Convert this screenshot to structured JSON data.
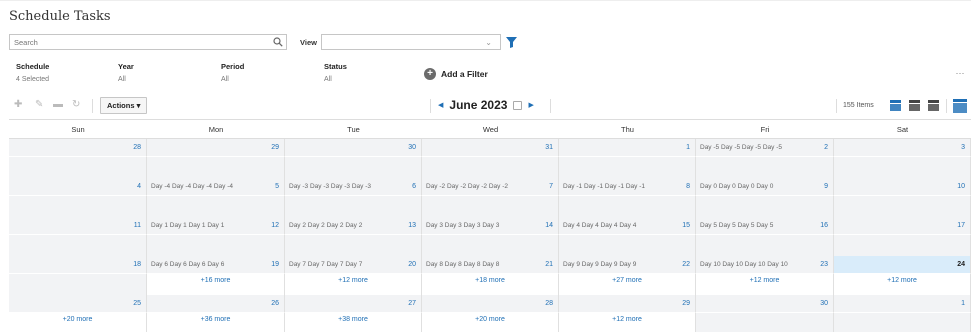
{
  "page": {
    "title": "Schedule Tasks"
  },
  "search": {
    "placeholder": "Search"
  },
  "view": {
    "label": "View",
    "value": ""
  },
  "filters": [
    {
      "label": "Schedule",
      "value": "4 Selected"
    },
    {
      "label": "Year",
      "value": "All"
    },
    {
      "label": "Period",
      "value": "All"
    },
    {
      "label": "Status",
      "value": "All"
    }
  ],
  "add_filter": {
    "label": "Add a Filter"
  },
  "toolbar": {
    "actions_label": "Actions",
    "month": "June 2023",
    "count": "155 Items"
  },
  "calendar": {
    "days": [
      "Sun",
      "Mon",
      "Tue",
      "Wed",
      "Thu",
      "Fri",
      "Sat"
    ],
    "weeks": [
      {
        "dates": [
          "28",
          "29",
          "30",
          "31",
          "1",
          "2",
          "3"
        ],
        "events": [
          "",
          "",
          "",
          "",
          "",
          "Day -5 Day -5 Day -5 Day -5",
          ""
        ],
        "more": [
          "",
          "",
          "",
          "",
          "",
          "",
          ""
        ]
      },
      {
        "dates": [
          "4",
          "5",
          "6",
          "7",
          "8",
          "9",
          "10"
        ],
        "events": [
          "",
          "Day -4 Day -4 Day -4 Day -4",
          "Day -3 Day -3 Day -3 Day -3",
          "Day -2 Day -2 Day -2 Day -2",
          "Day -1 Day -1 Day -1 Day -1",
          "Day 0 Day 0 Day 0 Day 0",
          ""
        ],
        "more": [
          "",
          "",
          "",
          "",
          "",
          "",
          ""
        ]
      },
      {
        "dates": [
          "11",
          "12",
          "13",
          "14",
          "15",
          "16",
          "17"
        ],
        "events": [
          "",
          "Day 1 Day 1 Day 1 Day 1",
          "Day 2 Day 2 Day 2 Day 2",
          "Day 3 Day 3 Day 3 Day 3",
          "Day 4 Day 4 Day 4 Day 4",
          "Day 5 Day 5 Day 5 Day 5",
          ""
        ],
        "more": [
          "",
          "",
          "",
          "",
          "",
          "",
          ""
        ]
      },
      {
        "dates": [
          "18",
          "19",
          "20",
          "21",
          "22",
          "23",
          "24"
        ],
        "events": [
          "",
          "Day 6 Day 6 Day 6 Day 6",
          "Day 7 Day 7 Day 7 Day 7",
          "Day 8 Day 8 Day 8 Day 8",
          "Day 9 Day 9 Day 9 Day 9",
          "Day 10 Day 10 Day 10 Day 10",
          ""
        ],
        "more": [
          "",
          "+16 more",
          "+12 more",
          "+18 more",
          "+27 more",
          "+12 more",
          "+12 more"
        ]
      },
      {
        "dates": [
          "25",
          "26",
          "27",
          "28",
          "29",
          "30",
          "1"
        ],
        "events": [
          "",
          "",
          "",
          "",
          "",
          "",
          ""
        ],
        "more": [
          "+20 more",
          "+36 more",
          "+38 more",
          "+20 more",
          "+12 more",
          "",
          ""
        ]
      }
    ]
  },
  "colors": {
    "accent": "#1f6fb5",
    "today": "#d9ecfa",
    "cell": "#f2f3f5"
  }
}
